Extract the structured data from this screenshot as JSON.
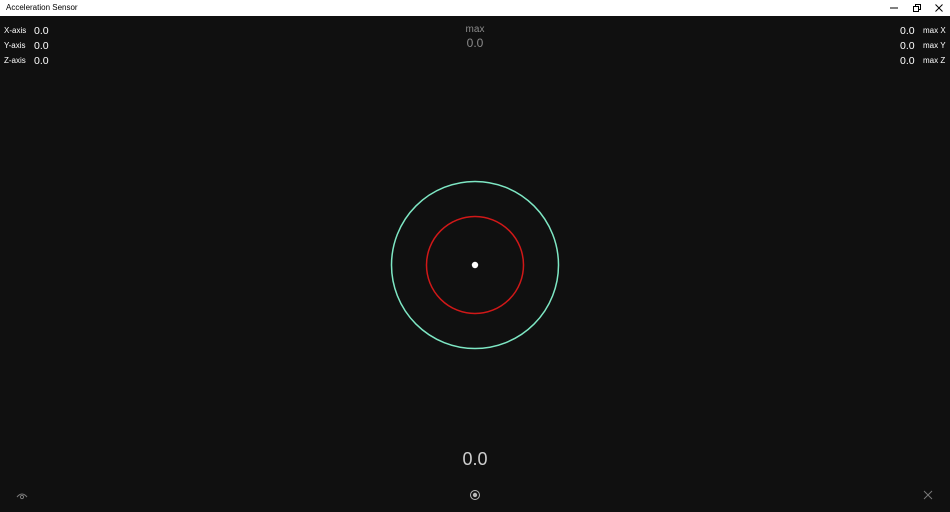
{
  "window": {
    "title": "Acceleration Sensor"
  },
  "axes": [
    {
      "label": "X-axis",
      "value": "0.0"
    },
    {
      "label": "Y-axis",
      "value": "0.0"
    },
    {
      "label": "Z-axis",
      "value": "0.0"
    }
  ],
  "max_panel": {
    "label": "max",
    "value": "0.0"
  },
  "max_axes": [
    {
      "label": "max X",
      "value": "0.0"
    },
    {
      "label": "max Y",
      "value": "0.0"
    },
    {
      "label": "max Z",
      "value": "0.0"
    }
  ],
  "magnitude": "0.0",
  "colors": {
    "background": "#101010",
    "outer_ring": "#7ee7c4",
    "inner_ring": "#d01818",
    "indicator": "#ffffff"
  },
  "icons": {
    "left": "eye-icon",
    "center": "record-icon",
    "right": "close-icon"
  }
}
